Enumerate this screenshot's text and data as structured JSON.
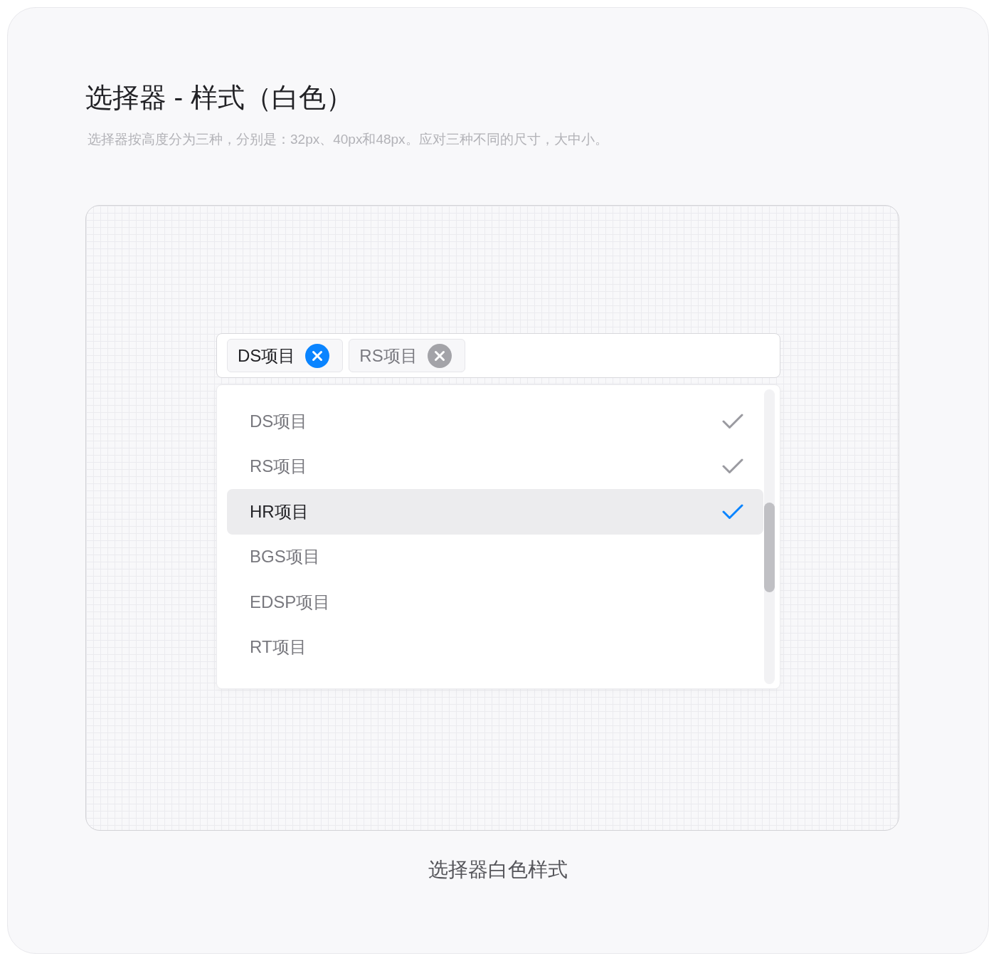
{
  "page": {
    "title": "选择器 - 样式（白色）",
    "description": "选择器按高度分为三种，分别是：32px、40px和48px。应对三种不同的尺寸，大中小。"
  },
  "select": {
    "tags": [
      {
        "label": "DS项目",
        "highlighted": true
      },
      {
        "label": "RS项目",
        "highlighted": false
      }
    ],
    "options": [
      {
        "label": "DS项目",
        "checked": true,
        "highlighted": false
      },
      {
        "label": "RS项目",
        "checked": true,
        "highlighted": false
      },
      {
        "label": "HR项目",
        "checked": true,
        "highlighted": true
      },
      {
        "label": "BGS项目",
        "checked": false,
        "highlighted": false
      },
      {
        "label": "EDSP项目",
        "checked": false,
        "highlighted": false
      },
      {
        "label": "RT项目",
        "checked": false,
        "highlighted": false
      }
    ]
  },
  "caption": "选择器白色样式"
}
